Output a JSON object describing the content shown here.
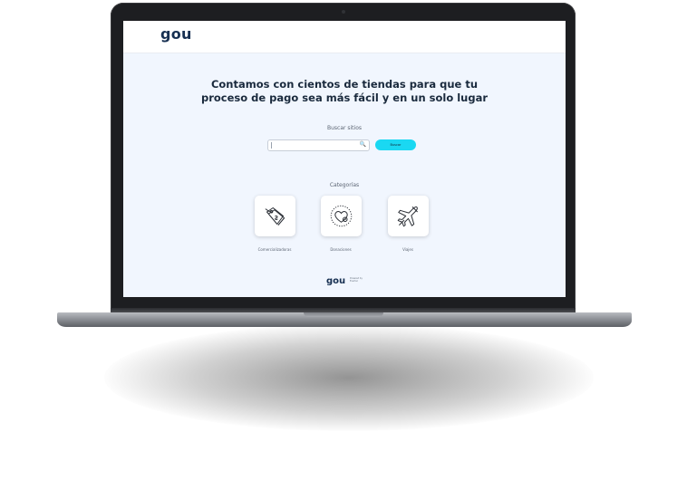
{
  "brand": {
    "logo_text": "gou",
    "footer_logo_text": "gou",
    "footer_note": "Powered by Evertec"
  },
  "hero": {
    "line1": "Contamos con cientos de tiendas para que tu",
    "line2": "proceso de pago sea más fácil y en un solo lugar"
  },
  "search": {
    "label": "Buscar sitios",
    "value": "",
    "button_label": "Buscar",
    "icon": "search-icon"
  },
  "categories": {
    "title": "Categorías",
    "items": [
      {
        "label": "Comercializadoras",
        "icon": "price-tag-icon"
      },
      {
        "label": "Donaciones",
        "icon": "heart-donation-icon"
      },
      {
        "label": "Viajes",
        "icon": "airplane-icon"
      }
    ]
  },
  "colors": {
    "accent": "#1ad8f2",
    "brand": "#173052",
    "screen_bg": "#f1f6fe"
  }
}
